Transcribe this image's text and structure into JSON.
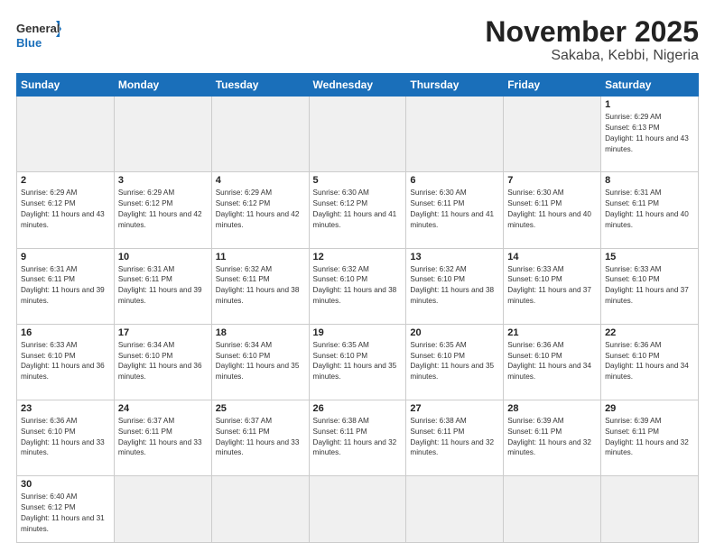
{
  "header": {
    "logo_general": "General",
    "logo_blue": "Blue",
    "title": "November 2025",
    "subtitle": "Sakaba, Kebbi, Nigeria"
  },
  "days_of_week": [
    "Sunday",
    "Monday",
    "Tuesday",
    "Wednesday",
    "Thursday",
    "Friday",
    "Saturday"
  ],
  "weeks": [
    {
      "cells": [
        {
          "empty": true
        },
        {
          "empty": true
        },
        {
          "empty": true
        },
        {
          "empty": true
        },
        {
          "empty": true
        },
        {
          "empty": true
        },
        {
          "day": "1",
          "sunrise": "6:29 AM",
          "sunset": "6:13 PM",
          "daylight": "11 hours and 43 minutes."
        }
      ]
    },
    {
      "cells": [
        {
          "day": "2",
          "sunrise": "6:29 AM",
          "sunset": "6:12 PM",
          "daylight": "11 hours and 43 minutes."
        },
        {
          "day": "3",
          "sunrise": "6:29 AM",
          "sunset": "6:12 PM",
          "daylight": "11 hours and 42 minutes."
        },
        {
          "day": "4",
          "sunrise": "6:29 AM",
          "sunset": "6:12 PM",
          "daylight": "11 hours and 42 minutes."
        },
        {
          "day": "5",
          "sunrise": "6:30 AM",
          "sunset": "6:12 PM",
          "daylight": "11 hours and 41 minutes."
        },
        {
          "day": "6",
          "sunrise": "6:30 AM",
          "sunset": "6:11 PM",
          "daylight": "11 hours and 41 minutes."
        },
        {
          "day": "7",
          "sunrise": "6:30 AM",
          "sunset": "6:11 PM",
          "daylight": "11 hours and 40 minutes."
        },
        {
          "day": "8",
          "sunrise": "6:31 AM",
          "sunset": "6:11 PM",
          "daylight": "11 hours and 40 minutes."
        }
      ]
    },
    {
      "cells": [
        {
          "day": "9",
          "sunrise": "6:31 AM",
          "sunset": "6:11 PM",
          "daylight": "11 hours and 39 minutes."
        },
        {
          "day": "10",
          "sunrise": "6:31 AM",
          "sunset": "6:11 PM",
          "daylight": "11 hours and 39 minutes."
        },
        {
          "day": "11",
          "sunrise": "6:32 AM",
          "sunset": "6:11 PM",
          "daylight": "11 hours and 38 minutes."
        },
        {
          "day": "12",
          "sunrise": "6:32 AM",
          "sunset": "6:10 PM",
          "daylight": "11 hours and 38 minutes."
        },
        {
          "day": "13",
          "sunrise": "6:32 AM",
          "sunset": "6:10 PM",
          "daylight": "11 hours and 38 minutes."
        },
        {
          "day": "14",
          "sunrise": "6:33 AM",
          "sunset": "6:10 PM",
          "daylight": "11 hours and 37 minutes."
        },
        {
          "day": "15",
          "sunrise": "6:33 AM",
          "sunset": "6:10 PM",
          "daylight": "11 hours and 37 minutes."
        }
      ]
    },
    {
      "cells": [
        {
          "day": "16",
          "sunrise": "6:33 AM",
          "sunset": "6:10 PM",
          "daylight": "11 hours and 36 minutes."
        },
        {
          "day": "17",
          "sunrise": "6:34 AM",
          "sunset": "6:10 PM",
          "daylight": "11 hours and 36 minutes."
        },
        {
          "day": "18",
          "sunrise": "6:34 AM",
          "sunset": "6:10 PM",
          "daylight": "11 hours and 35 minutes."
        },
        {
          "day": "19",
          "sunrise": "6:35 AM",
          "sunset": "6:10 PM",
          "daylight": "11 hours and 35 minutes."
        },
        {
          "day": "20",
          "sunrise": "6:35 AM",
          "sunset": "6:10 PM",
          "daylight": "11 hours and 35 minutes."
        },
        {
          "day": "21",
          "sunrise": "6:36 AM",
          "sunset": "6:10 PM",
          "daylight": "11 hours and 34 minutes."
        },
        {
          "day": "22",
          "sunrise": "6:36 AM",
          "sunset": "6:10 PM",
          "daylight": "11 hours and 34 minutes."
        }
      ]
    },
    {
      "cells": [
        {
          "day": "23",
          "sunrise": "6:36 AM",
          "sunset": "6:10 PM",
          "daylight": "11 hours and 33 minutes."
        },
        {
          "day": "24",
          "sunrise": "6:37 AM",
          "sunset": "6:11 PM",
          "daylight": "11 hours and 33 minutes."
        },
        {
          "day": "25",
          "sunrise": "6:37 AM",
          "sunset": "6:11 PM",
          "daylight": "11 hours and 33 minutes."
        },
        {
          "day": "26",
          "sunrise": "6:38 AM",
          "sunset": "6:11 PM",
          "daylight": "11 hours and 32 minutes."
        },
        {
          "day": "27",
          "sunrise": "6:38 AM",
          "sunset": "6:11 PM",
          "daylight": "11 hours and 32 minutes."
        },
        {
          "day": "28",
          "sunrise": "6:39 AM",
          "sunset": "6:11 PM",
          "daylight": "11 hours and 32 minutes."
        },
        {
          "day": "29",
          "sunrise": "6:39 AM",
          "sunset": "6:11 PM",
          "daylight": "11 hours and 32 minutes."
        }
      ]
    },
    {
      "cells": [
        {
          "day": "30",
          "sunrise": "6:40 AM",
          "sunset": "6:12 PM",
          "daylight": "11 hours and 31 minutes."
        },
        {
          "empty": true
        },
        {
          "empty": true
        },
        {
          "empty": true
        },
        {
          "empty": true
        },
        {
          "empty": true
        },
        {
          "empty": true
        }
      ]
    }
  ]
}
